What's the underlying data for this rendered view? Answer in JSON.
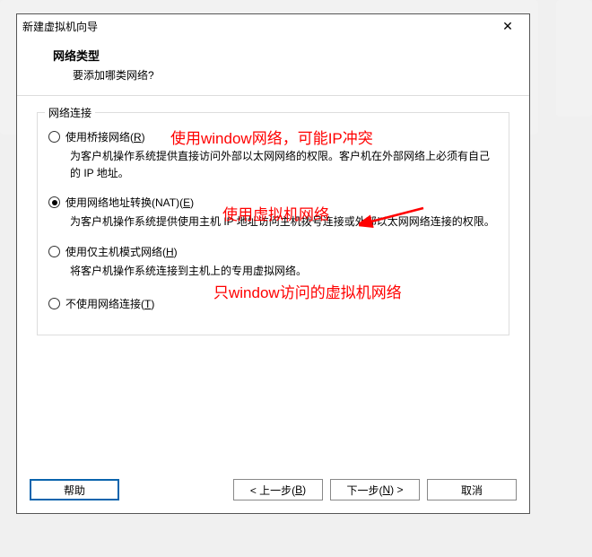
{
  "dialog": {
    "title": "新建虚拟机向导",
    "close": "✕"
  },
  "header": {
    "title": "网络类型",
    "subtitle": "要添加哪类网络?"
  },
  "group": {
    "label": "网络连接"
  },
  "options": {
    "bridged": {
      "label_pre": "使用桥接网络(",
      "key": "R",
      "label_post": ")",
      "desc": "为客户机操作系统提供直接访问外部以太网网络的权限。客户机在外部网络上必须有自己的 IP 地址。"
    },
    "nat": {
      "label_pre": "使用网络地址转换(NAT)(",
      "key": "E",
      "label_post": ")",
      "desc": "为客户机操作系统提供使用主机 IP 地址访问主机拨号连接或外部以太网网络连接的权限。"
    },
    "hostonly": {
      "label_pre": "使用仅主机模式网络(",
      "key": "H",
      "label_post": ")",
      "desc": "将客户机操作系统连接到主机上的专用虚拟网络。"
    },
    "none": {
      "label_pre": "不使用网络连接(",
      "key": "T",
      "label_post": ")"
    }
  },
  "buttons": {
    "help": "帮助",
    "back_pre": "< 上一步(",
    "back_key": "B",
    "back_post": ")",
    "next_pre": "下一步(",
    "next_key": "N",
    "next_post": ") >",
    "cancel": "取消"
  },
  "annotations": {
    "a1": "使用window网络，可能IP冲突",
    "a2": "使用虚拟机网络",
    "a3": "只window访问的虚拟机网络"
  }
}
